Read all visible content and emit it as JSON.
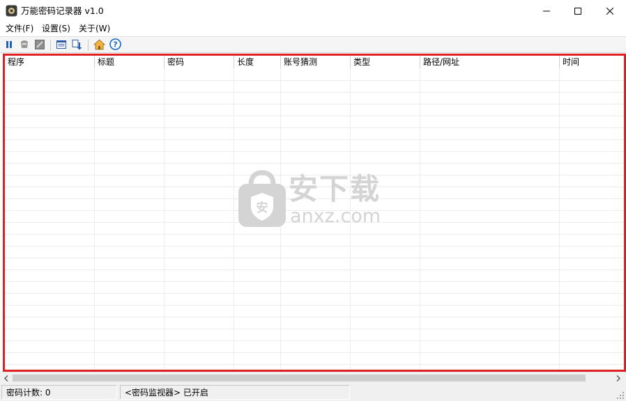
{
  "window": {
    "title": "万能密码记录器 v1.0"
  },
  "menu": [
    {
      "label": "文件(F)"
    },
    {
      "label": "设置(S)"
    },
    {
      "label": "关于(W)"
    }
  ],
  "toolbar": {
    "icons": [
      "pause-icon",
      "clear-icon",
      "stop-icon",
      "list-icon",
      "export-icon",
      "home-icon",
      "help-icon"
    ]
  },
  "table": {
    "columns": [
      "程序",
      "标题",
      "密码",
      "长度",
      "账号猜测",
      "类型",
      "路径/网址",
      "时间"
    ],
    "rows": []
  },
  "status": {
    "count_label": "密码计数:  0",
    "monitor_label": "<密码监视器> 已开启"
  },
  "watermark": {
    "cn": "安下载",
    "en": "anxz.com",
    "badge": "安"
  },
  "colors": {
    "highlight_border": "#e02020",
    "help_blue": "#1565c0",
    "home_orange": "#e08a1e"
  }
}
